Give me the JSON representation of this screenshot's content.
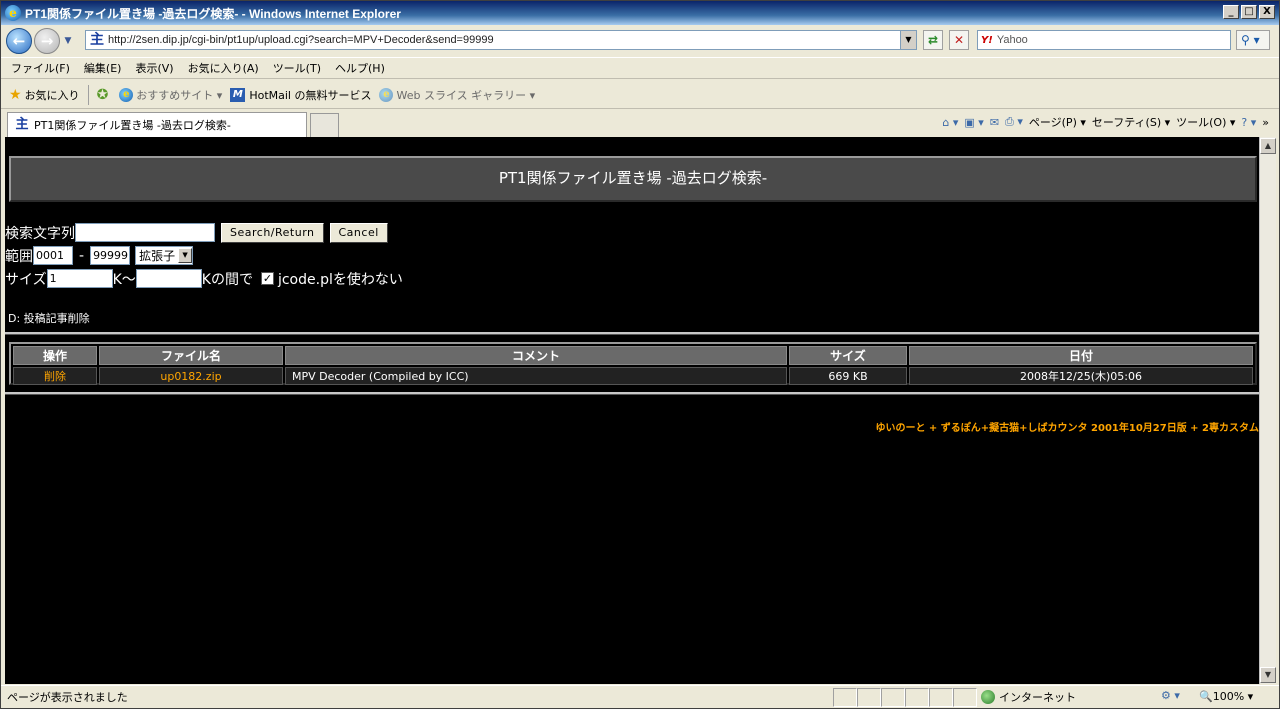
{
  "window": {
    "title": "PT1関係ファイル置き場 -過去ログ検索- - Windows Internet Explorer",
    "minimize": "_",
    "maximize": "□",
    "close": "X"
  },
  "address": {
    "url": "http://2sen.dip.jp/cgi-bin/pt1up/upload.cgi?search=MPV+Decoder&send=99999",
    "search_placeholder": "Yahoo",
    "search_engine": "Y!"
  },
  "menu": [
    "ファイル(F)",
    "編集(E)",
    "表示(V)",
    "お気に入り(A)",
    "ツール(T)",
    "ヘルプ(H)"
  ],
  "favorites": {
    "label": "お気に入り",
    "items": [
      "おすすめサイト ▾",
      "HotMail の無料サービス",
      "Web スライス ギャラリー ▾"
    ]
  },
  "tab": {
    "title": "PT1関係ファイル置き場 -過去ログ検索-"
  },
  "commandbar": {
    "page": "ページ(P) ▾",
    "safety": "セーフティ(S) ▾",
    "tools": "ツール(O) ▾",
    "help": "? ▾"
  },
  "page": {
    "heading": "PT1関係ファイル置き場 -過去ログ検索-",
    "form": {
      "search_label": "検索文字列",
      "search_value": "",
      "search_button": "Search/Return",
      "cancel_button": "Cancel",
      "range_label": "範囲",
      "range_from": "0001",
      "range_sep": "-",
      "range_to": "99999",
      "ext_select": "拡張子",
      "size_label": "サイズ",
      "size_min": "1",
      "size_unit": "K～",
      "size_max": "",
      "size_suffix": "Kの間で",
      "jcode_checked": true,
      "jcode_label": "jcode.plを使わない"
    },
    "delete_note": "D: 投稿記事削除",
    "table": {
      "headers": [
        "操作",
        "ファイル名",
        "コメント",
        "サイズ",
        "日付"
      ],
      "rows": [
        {
          "action": "削除",
          "filename": "up0182.zip",
          "comment": "MPV Decoder (Compiled by ICC)",
          "size": "669 KB",
          "date": "2008年12/25(木)05:06"
        }
      ]
    },
    "footer": "ゆいのーと + ずるぽん+擬古猫+しばカウンタ 2001年10月27日版 + 2専カスタム"
  },
  "status": {
    "message": "ページが表示されました",
    "zone": "インターネット",
    "zoom": "100%"
  },
  "colors": {
    "background": "#000000",
    "link": "#ffa500",
    "header_bg": "#4a4a4a"
  }
}
